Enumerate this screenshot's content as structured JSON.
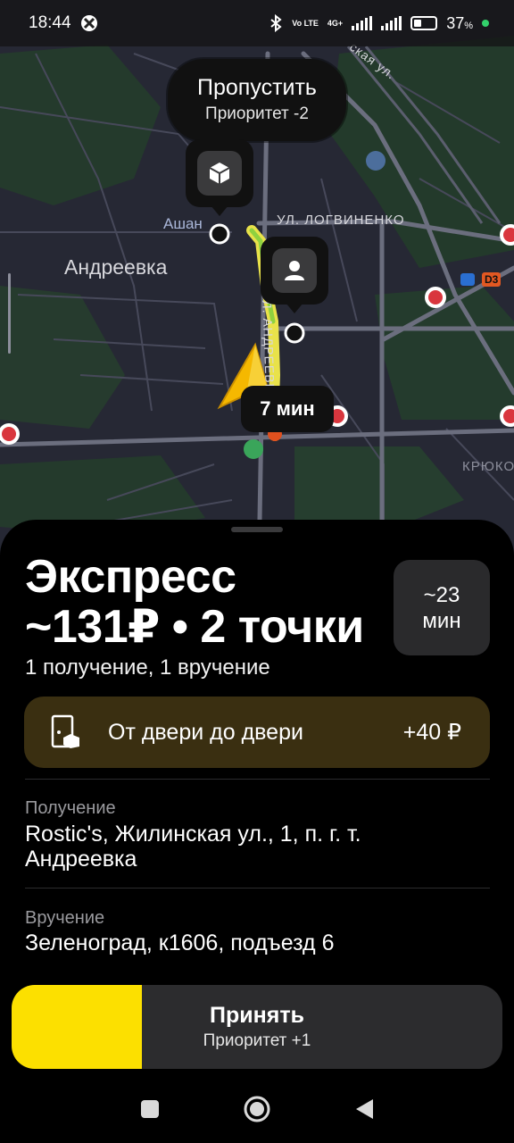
{
  "status_bar": {
    "time": "18:44",
    "network_type": "4G+",
    "volte_label": "Vo LTE",
    "battery_percent": "37",
    "battery_unit": "%"
  },
  "map": {
    "labels": {
      "locality": "Андреевка",
      "store": "Ашан",
      "street_1": "ул. Логвиненко",
      "street_2": "ул. Андреевка",
      "street_3": "ская ул.",
      "district": "Крюко",
      "road_badge": "D3"
    },
    "skip_bubble": {
      "title": "Пропустить",
      "subtitle": "Приоритет -2"
    },
    "eta": "7 мин"
  },
  "order": {
    "title_line1": "Экспресс",
    "title_line2": "~131₽ • 2 точки",
    "subtitle": "1 получение, 1 вручение",
    "time_value": "~23",
    "time_unit": "мин",
    "door_option": {
      "label": "От двери до двери",
      "price": "+40 ₽"
    },
    "pickup": {
      "caption": "Получение",
      "address": "Rostic's, Жилинская ул., 1, п. г. т. Андреевка"
    },
    "delivery": {
      "caption": "Вручение",
      "address": "Зеленоград, к1606, подъезд 6"
    },
    "accept_button": {
      "label": "Принять",
      "subtitle": "Приоритет +1",
      "progress_fraction": 0.265
    }
  },
  "colors": {
    "accent_yellow": "#fce000",
    "door_bar": "#3a2f11",
    "map_bg": "#262834",
    "route": "#f2e94e"
  },
  "icons": {
    "navigation": [
      "square-icon",
      "home-circle-icon",
      "back-triangle-icon"
    ]
  }
}
